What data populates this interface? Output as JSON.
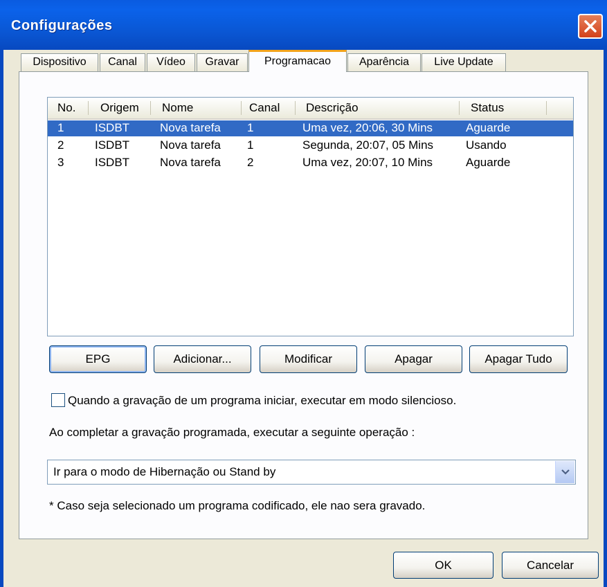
{
  "window": {
    "title": "Configurações"
  },
  "tabs": [
    {
      "label": "Dispositivo"
    },
    {
      "label": "Canal"
    },
    {
      "label": "Vídeo"
    },
    {
      "label": "Gravar"
    },
    {
      "label": "Programacao"
    },
    {
      "label": "Aparência"
    },
    {
      "label": "Live Update"
    }
  ],
  "schedule": {
    "columns": [
      "No.",
      "Origem",
      "Nome",
      "Canal",
      "Descrição",
      "Status"
    ],
    "rows": [
      {
        "no": "1",
        "origem": "ISDBT",
        "nome": "Nova tarefa",
        "canal": "1",
        "descricao": "Uma vez, 20:06, 30 Mins",
        "status": "Aguarde"
      },
      {
        "no": "2",
        "origem": "ISDBT",
        "nome": "Nova tarefa",
        "canal": "1",
        "descricao": "Segunda, 20:07, 05 Mins",
        "status": "Usando"
      },
      {
        "no": "3",
        "origem": "ISDBT",
        "nome": "Nova tarefa",
        "canal": "2",
        "descricao": "Uma vez, 20:07, 10 Mins",
        "status": "Aguarde"
      }
    ]
  },
  "actions": {
    "epg": "EPG",
    "add": "Adicionar...",
    "modify": "Modificar",
    "delete": "Apagar",
    "delete_all": "Apagar Tudo"
  },
  "silent_mode": {
    "label": "Quando a gravação de um programa iniciar, executar em modo silencioso.",
    "checked": false
  },
  "completion": {
    "label": "Ao completar a gravação programada, executar a seguinte operação :",
    "selected": "Ir para o modo de Hibernação ou Stand by"
  },
  "note": "* Caso seja selecionado um programa codificado, ele nao sera gravado.",
  "footer": {
    "ok": "OK",
    "cancel": "Cancelar"
  },
  "colors": {
    "titlebar": "#0a5be0",
    "selection": "#316ac5",
    "active_tab_accent": "#f2a31b",
    "dialog_bg": "#ece9d8"
  }
}
